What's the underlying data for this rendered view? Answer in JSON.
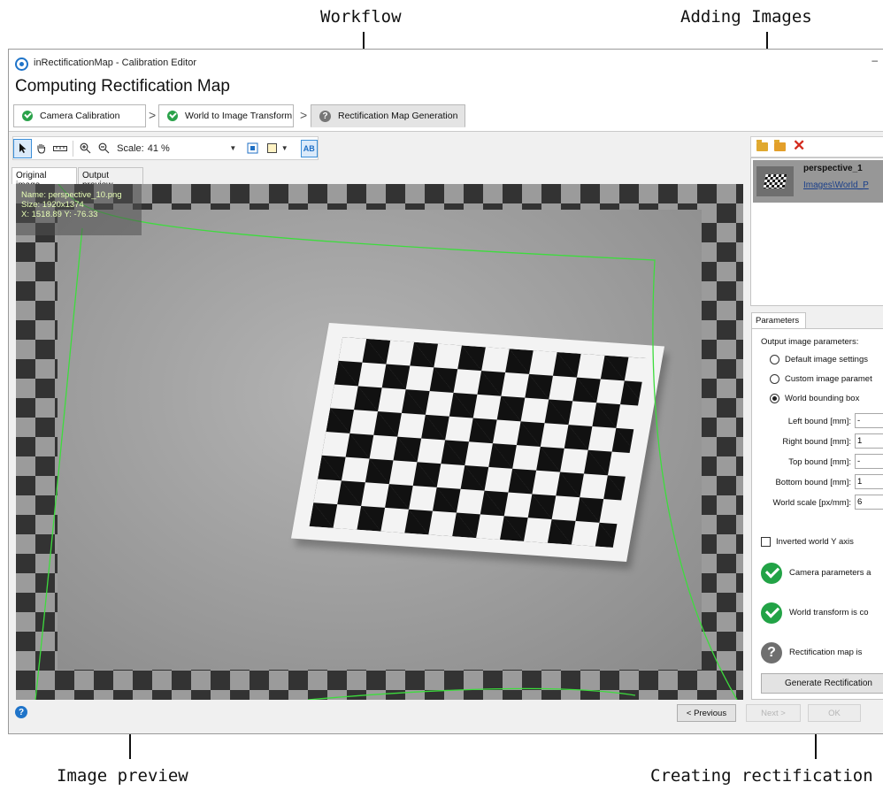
{
  "annotations": {
    "workflow": "Workflow",
    "adding_images": "Adding Images",
    "image_preview": "Image preview",
    "creating_map": "Creating rectification m"
  },
  "window": {
    "title": "inRectificationMap - Calibration Editor",
    "minimize": "–"
  },
  "page_title": "Computing Rectification Map",
  "workflow_tabs": [
    {
      "label": "Camera Calibration",
      "status": "done"
    },
    {
      "label": "World to Image Transform",
      "status": "done"
    },
    {
      "label": "Rectification Map Generation",
      "status": "current"
    }
  ],
  "toolbar": {
    "scale_label": "Scale:",
    "scale_value": "41 %",
    "ab_label": "AB"
  },
  "image_tabs": {
    "original": "Original image",
    "output": "Output preview"
  },
  "preview_info": {
    "name": "Name: perspective_10.png",
    "size": "Size: 1920x1374",
    "coords": "X: 1518.89 Y: -76.33"
  },
  "image_list": [
    {
      "name": "perspective_1",
      "path": "Images\\World_P"
    }
  ],
  "parameters": {
    "tab": "Parameters",
    "section_label": "Output image parameters:",
    "options": [
      {
        "label": "Default image settings",
        "checked": false
      },
      {
        "label": "Custom image paramet",
        "checked": false
      },
      {
        "label": "World bounding box",
        "checked": true
      }
    ],
    "fields": [
      {
        "label": "Left bound [mm]:",
        "value": "-"
      },
      {
        "label": "Right bound [mm]:",
        "value": "1"
      },
      {
        "label": "Top bound [mm]:",
        "value": "-"
      },
      {
        "label": "Bottom bound [mm]:",
        "value": "1"
      },
      {
        "label": "World scale [px/mm]:",
        "value": "6"
      }
    ],
    "inverted_axis": "Inverted world Y axis",
    "status": [
      {
        "text": "Camera parameters a",
        "state": "ok"
      },
      {
        "text": "World transform is co",
        "state": "ok"
      },
      {
        "text": "Rectification map is",
        "state": "unknown"
      }
    ],
    "generate_button": "Generate Rectification"
  },
  "footer": {
    "help": "?",
    "previous": "< Previous",
    "next": "Next >",
    "ok": "OK"
  },
  "colors": {
    "accent": "#1f74c9",
    "ok_green": "#22a346",
    "overlay_text": "#e8ffb5",
    "distortion_curve": "#3ddc3d"
  }
}
